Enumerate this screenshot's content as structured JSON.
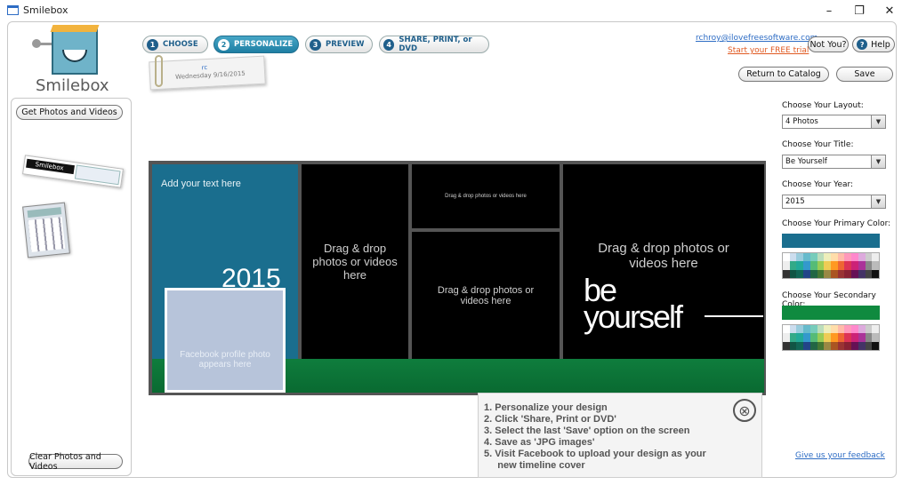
{
  "window": {
    "title": "Smilebox",
    "minimize": "–",
    "maximize": "❐",
    "close": "✕"
  },
  "logo": {
    "text": "Smilebox"
  },
  "steps": [
    {
      "num": "1",
      "label": "CHOOSE"
    },
    {
      "num": "2",
      "label": "PERSONALIZE"
    },
    {
      "num": "3",
      "label": "PREVIEW"
    },
    {
      "num": "4",
      "label": "SHARE, PRINT, or DVD"
    }
  ],
  "tag": {
    "initials": "rc",
    "date": "Wednesday 9/16/2015"
  },
  "user": {
    "email": "rchroy@ilovefreesoftware.com",
    "trial": "Start your FREE trial",
    "not_you": "Not You?",
    "help": "Help"
  },
  "actions": {
    "return_catalog": "Return to Catalog",
    "save": "Save"
  },
  "sidebar": {
    "get_photos": "Get Photos and Videos",
    "clear_photos": "Clear Photos and Videos",
    "thumb1_label": "Smilebox"
  },
  "canvas": {
    "add_text": "Add your text here",
    "year": "2015",
    "fb_profile": "Facebook profile photo appears here",
    "drop_medium": "Drag & drop photos or videos here",
    "drop_small": "Drag & drop photos or videos here",
    "drop_mid": "Drag & drop photos or videos here",
    "drop_large": "Drag & drop photos or videos here",
    "title_line1": "be",
    "title_line2": "yourself"
  },
  "options": {
    "layout_label": "Choose Your Layout:",
    "layout_value": "4 Photos",
    "title_label": "Choose Your Title:",
    "title_value": "Be Yourself",
    "year_label": "Choose Your Year:",
    "year_value": "2015",
    "primary_label": "Choose Your Primary Color:",
    "primary_color": "#1a6e8e",
    "secondary_label": "Choose Your Secondary Color:",
    "secondary_color": "#0f8a3f",
    "dropdown_arrow": "▼"
  },
  "instructions": {
    "items": [
      "1.  Personalize your design",
      "2.  Click 'Share, Print or DVD'",
      "3.  Select the last 'Save' option on the screen",
      "4.  Save as 'JPG images'",
      "5.  Visit Facebook to upload your design as your",
      "     new timeline cover"
    ],
    "close": "⊗"
  },
  "feedback": "Give us your feedback",
  "colors": {
    "accent": "#1f7fa3",
    "canvas_primary": "#1a6e8e",
    "canvas_secondary": "#0f7d3d"
  }
}
